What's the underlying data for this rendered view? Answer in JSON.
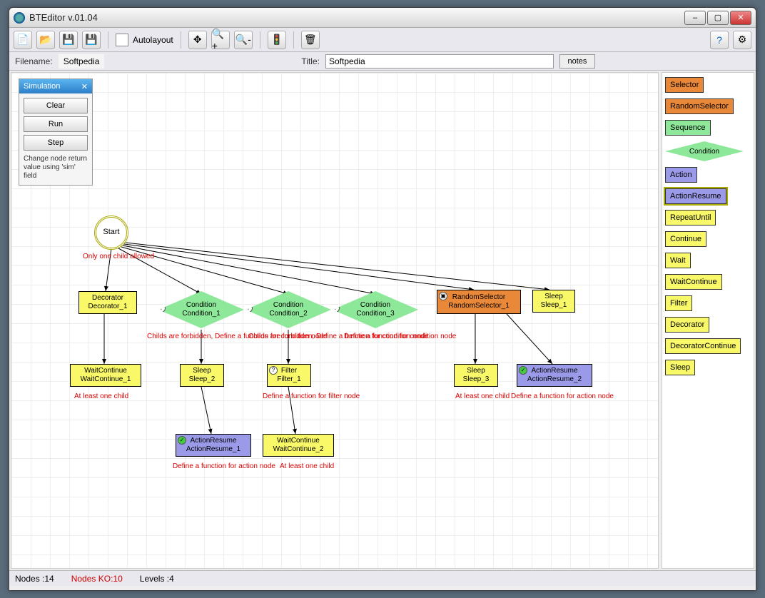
{
  "window": {
    "title": "BTEditor v.01.04"
  },
  "toolbar": {
    "autolayout_label": "Autolayout"
  },
  "filebar": {
    "filename_label": "Filename:",
    "filename_value": "Softpedia",
    "title_label": "Title:",
    "title_value": "Softpedia",
    "notes_label": "notes"
  },
  "sim": {
    "header": "Simulation",
    "clear": "Clear",
    "run": "Run",
    "step": "Step",
    "note": "Change node return value using 'sim' field"
  },
  "palette": [
    {
      "label": "Selector",
      "cls": "orange"
    },
    {
      "label": "RandomSelector",
      "cls": "orange"
    },
    {
      "label": "Sequence",
      "cls": "green"
    },
    {
      "label": "Condition",
      "cls": "diamond"
    },
    {
      "label": "Action",
      "cls": "blue"
    },
    {
      "label": "ActionResume",
      "cls": "blue"
    },
    {
      "label": "RepeatUntil",
      "cls": "yellow"
    },
    {
      "label": "Continue",
      "cls": "yellow"
    },
    {
      "label": "Wait",
      "cls": "yellow"
    },
    {
      "label": "WaitContinue",
      "cls": "yellow"
    },
    {
      "label": "Filter",
      "cls": "yellow"
    },
    {
      "label": "Decorator",
      "cls": "yellow"
    },
    {
      "label": "DecoratorContinue",
      "cls": "yellow"
    },
    {
      "label": "Sleep",
      "cls": "yellow"
    }
  ],
  "status": {
    "nodes_label": "Nodes :",
    "nodes": "14",
    "ko_label": "Nodes KO:",
    "ko": "10",
    "levels_label": "Levels :",
    "levels": "4"
  },
  "nodes": {
    "start": "Start",
    "decorator": {
      "t1": "Decorator",
      "t2": "Decorator_1"
    },
    "cond1": {
      "t1": "Condition",
      "t2": "Condition_1"
    },
    "cond2": {
      "t1": "Condition",
      "t2": "Condition_2"
    },
    "cond3": {
      "t1": "Condition",
      "t2": "Condition_3"
    },
    "rand": {
      "t1": "RandomSelector",
      "t2": "RandomSelector_1"
    },
    "sleep1": {
      "t1": "Sleep",
      "t2": "Sleep_1"
    },
    "wc1": {
      "t1": "WaitContinue",
      "t2": "WaitContinue_1"
    },
    "sleep2": {
      "t1": "Sleep",
      "t2": "Sleep_2"
    },
    "filter1": {
      "t1": "Filter",
      "t2": "Filter_1"
    },
    "sleep3": {
      "t1": "Sleep",
      "t2": "Sleep_3"
    },
    "ar2": {
      "t1": "ActionResume",
      "t2": "ActionResume_2"
    },
    "ar1": {
      "t1": "ActionResume",
      "t2": "ActionResume_1"
    },
    "wc2": {
      "t1": "WaitContinue",
      "t2": "WaitContinue_2"
    }
  },
  "errors": {
    "e1": "Only one child allowed",
    "e2": "Childs are forbidden, Define a function for condition node",
    "e3": "Childs are forbidden, Define a function for condition node",
    "e4": "Define a function for condition node",
    "e5": "At least one child",
    "e6": "Define a function for filter node",
    "e7": "At least one child",
    "e8": "Define a function for action node",
    "e9": "Define a function for action node",
    "e10": "At least one child"
  }
}
